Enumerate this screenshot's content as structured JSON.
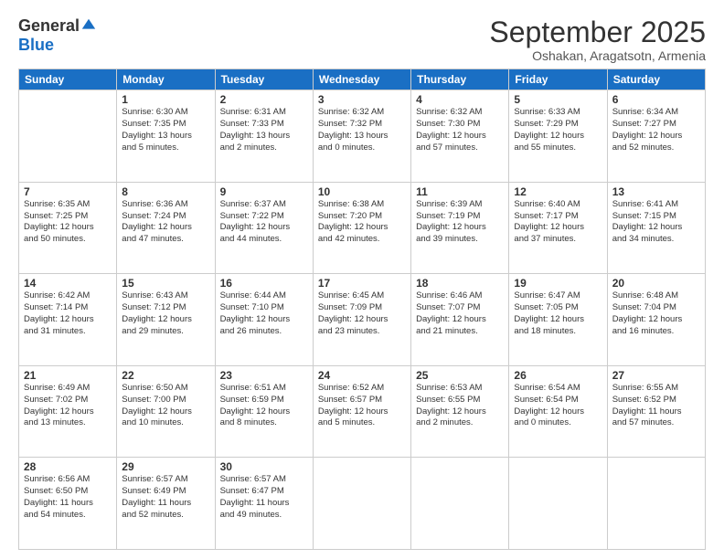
{
  "logo": {
    "general": "General",
    "blue": "Blue"
  },
  "header": {
    "month": "September 2025",
    "location": "Oshakan, Aragatsotn, Armenia"
  },
  "weekdays": [
    "Sunday",
    "Monday",
    "Tuesday",
    "Wednesday",
    "Thursday",
    "Friday",
    "Saturday"
  ],
  "weeks": [
    [
      {
        "day": "",
        "info": ""
      },
      {
        "day": "1",
        "info": "Sunrise: 6:30 AM\nSunset: 7:35 PM\nDaylight: 13 hours\nand 5 minutes."
      },
      {
        "day": "2",
        "info": "Sunrise: 6:31 AM\nSunset: 7:33 PM\nDaylight: 13 hours\nand 2 minutes."
      },
      {
        "day": "3",
        "info": "Sunrise: 6:32 AM\nSunset: 7:32 PM\nDaylight: 13 hours\nand 0 minutes."
      },
      {
        "day": "4",
        "info": "Sunrise: 6:32 AM\nSunset: 7:30 PM\nDaylight: 12 hours\nand 57 minutes."
      },
      {
        "day": "5",
        "info": "Sunrise: 6:33 AM\nSunset: 7:29 PM\nDaylight: 12 hours\nand 55 minutes."
      },
      {
        "day": "6",
        "info": "Sunrise: 6:34 AM\nSunset: 7:27 PM\nDaylight: 12 hours\nand 52 minutes."
      }
    ],
    [
      {
        "day": "7",
        "info": "Sunrise: 6:35 AM\nSunset: 7:25 PM\nDaylight: 12 hours\nand 50 minutes."
      },
      {
        "day": "8",
        "info": "Sunrise: 6:36 AM\nSunset: 7:24 PM\nDaylight: 12 hours\nand 47 minutes."
      },
      {
        "day": "9",
        "info": "Sunrise: 6:37 AM\nSunset: 7:22 PM\nDaylight: 12 hours\nand 44 minutes."
      },
      {
        "day": "10",
        "info": "Sunrise: 6:38 AM\nSunset: 7:20 PM\nDaylight: 12 hours\nand 42 minutes."
      },
      {
        "day": "11",
        "info": "Sunrise: 6:39 AM\nSunset: 7:19 PM\nDaylight: 12 hours\nand 39 minutes."
      },
      {
        "day": "12",
        "info": "Sunrise: 6:40 AM\nSunset: 7:17 PM\nDaylight: 12 hours\nand 37 minutes."
      },
      {
        "day": "13",
        "info": "Sunrise: 6:41 AM\nSunset: 7:15 PM\nDaylight: 12 hours\nand 34 minutes."
      }
    ],
    [
      {
        "day": "14",
        "info": "Sunrise: 6:42 AM\nSunset: 7:14 PM\nDaylight: 12 hours\nand 31 minutes."
      },
      {
        "day": "15",
        "info": "Sunrise: 6:43 AM\nSunset: 7:12 PM\nDaylight: 12 hours\nand 29 minutes."
      },
      {
        "day": "16",
        "info": "Sunrise: 6:44 AM\nSunset: 7:10 PM\nDaylight: 12 hours\nand 26 minutes."
      },
      {
        "day": "17",
        "info": "Sunrise: 6:45 AM\nSunset: 7:09 PM\nDaylight: 12 hours\nand 23 minutes."
      },
      {
        "day": "18",
        "info": "Sunrise: 6:46 AM\nSunset: 7:07 PM\nDaylight: 12 hours\nand 21 minutes."
      },
      {
        "day": "19",
        "info": "Sunrise: 6:47 AM\nSunset: 7:05 PM\nDaylight: 12 hours\nand 18 minutes."
      },
      {
        "day": "20",
        "info": "Sunrise: 6:48 AM\nSunset: 7:04 PM\nDaylight: 12 hours\nand 16 minutes."
      }
    ],
    [
      {
        "day": "21",
        "info": "Sunrise: 6:49 AM\nSunset: 7:02 PM\nDaylight: 12 hours\nand 13 minutes."
      },
      {
        "day": "22",
        "info": "Sunrise: 6:50 AM\nSunset: 7:00 PM\nDaylight: 12 hours\nand 10 minutes."
      },
      {
        "day": "23",
        "info": "Sunrise: 6:51 AM\nSunset: 6:59 PM\nDaylight: 12 hours\nand 8 minutes."
      },
      {
        "day": "24",
        "info": "Sunrise: 6:52 AM\nSunset: 6:57 PM\nDaylight: 12 hours\nand 5 minutes."
      },
      {
        "day": "25",
        "info": "Sunrise: 6:53 AM\nSunset: 6:55 PM\nDaylight: 12 hours\nand 2 minutes."
      },
      {
        "day": "26",
        "info": "Sunrise: 6:54 AM\nSunset: 6:54 PM\nDaylight: 12 hours\nand 0 minutes."
      },
      {
        "day": "27",
        "info": "Sunrise: 6:55 AM\nSunset: 6:52 PM\nDaylight: 11 hours\nand 57 minutes."
      }
    ],
    [
      {
        "day": "28",
        "info": "Sunrise: 6:56 AM\nSunset: 6:50 PM\nDaylight: 11 hours\nand 54 minutes."
      },
      {
        "day": "29",
        "info": "Sunrise: 6:57 AM\nSunset: 6:49 PM\nDaylight: 11 hours\nand 52 minutes."
      },
      {
        "day": "30",
        "info": "Sunrise: 6:57 AM\nSunset: 6:47 PM\nDaylight: 11 hours\nand 49 minutes."
      },
      {
        "day": "",
        "info": ""
      },
      {
        "day": "",
        "info": ""
      },
      {
        "day": "",
        "info": ""
      },
      {
        "day": "",
        "info": ""
      }
    ]
  ]
}
